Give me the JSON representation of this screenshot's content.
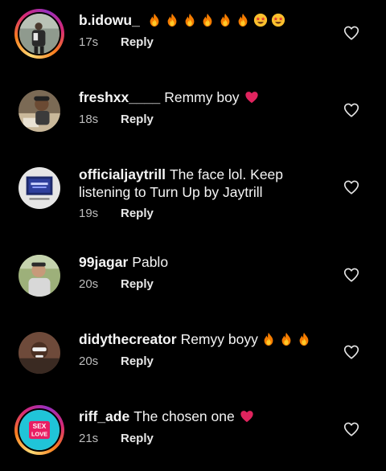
{
  "comments": [
    {
      "username": "b.idowu_",
      "text": "",
      "emoji": [
        "fire",
        "fire",
        "fire",
        "fire",
        "fire",
        "fire",
        "star-struck",
        "star-struck"
      ],
      "time": "17s",
      "reply": "Reply",
      "story_ring": true
    },
    {
      "username": "freshxx____",
      "text": "Remmy boy",
      "emoji": [
        "red-heart"
      ],
      "time": "18s",
      "reply": "Reply",
      "story_ring": false
    },
    {
      "username": "officialjaytrill",
      "text": "The face lol. Keep listening to Turn Up by Jaytrill",
      "emoji": [],
      "time": "19s",
      "reply": "Reply",
      "story_ring": false
    },
    {
      "username": "99jagar",
      "text": "Pablo",
      "emoji": [],
      "time": "20s",
      "reply": "Reply",
      "story_ring": false
    },
    {
      "username": "didythecreator",
      "text": "Remyy boyy",
      "emoji": [
        "fire",
        "fire",
        "fire"
      ],
      "time": "20s",
      "reply": "Reply",
      "story_ring": false
    },
    {
      "username": "riff_ade",
      "text": "The chosen one",
      "emoji": [
        "red-heart"
      ],
      "time": "21s",
      "reply": "Reply",
      "story_ring": true
    }
  ],
  "avatar_logo_text": {
    "line1": "SEX",
    "line2": "LOVE"
  },
  "icons": {
    "like": "heart-outline-icon",
    "fire": "fire-emoji",
    "star_struck": "star-struck-emoji",
    "heart": "red-heart-emoji"
  },
  "colors": {
    "background": "#000000",
    "text": "#f5f5f5",
    "meta": "#bdbdbd",
    "heart": "#e0245e"
  }
}
